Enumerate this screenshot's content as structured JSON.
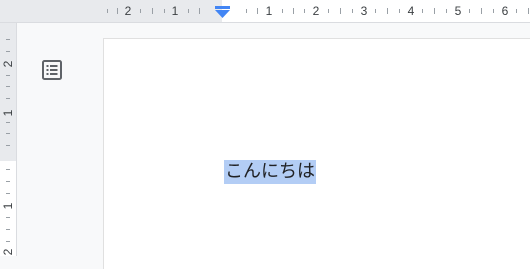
{
  "top_ruler": {
    "labels": [
      "2",
      "1",
      "1",
      "2",
      "3",
      "4",
      "5",
      "6"
    ]
  },
  "left_ruler": {
    "labels": [
      "2",
      "1",
      "1",
      "2"
    ]
  },
  "outline_icon": "document-outline-icon",
  "document": {
    "text": "こんにちは",
    "selected": true
  },
  "colors": {
    "selection": "#b3cdf5",
    "indent_marker": "#4285f4"
  }
}
